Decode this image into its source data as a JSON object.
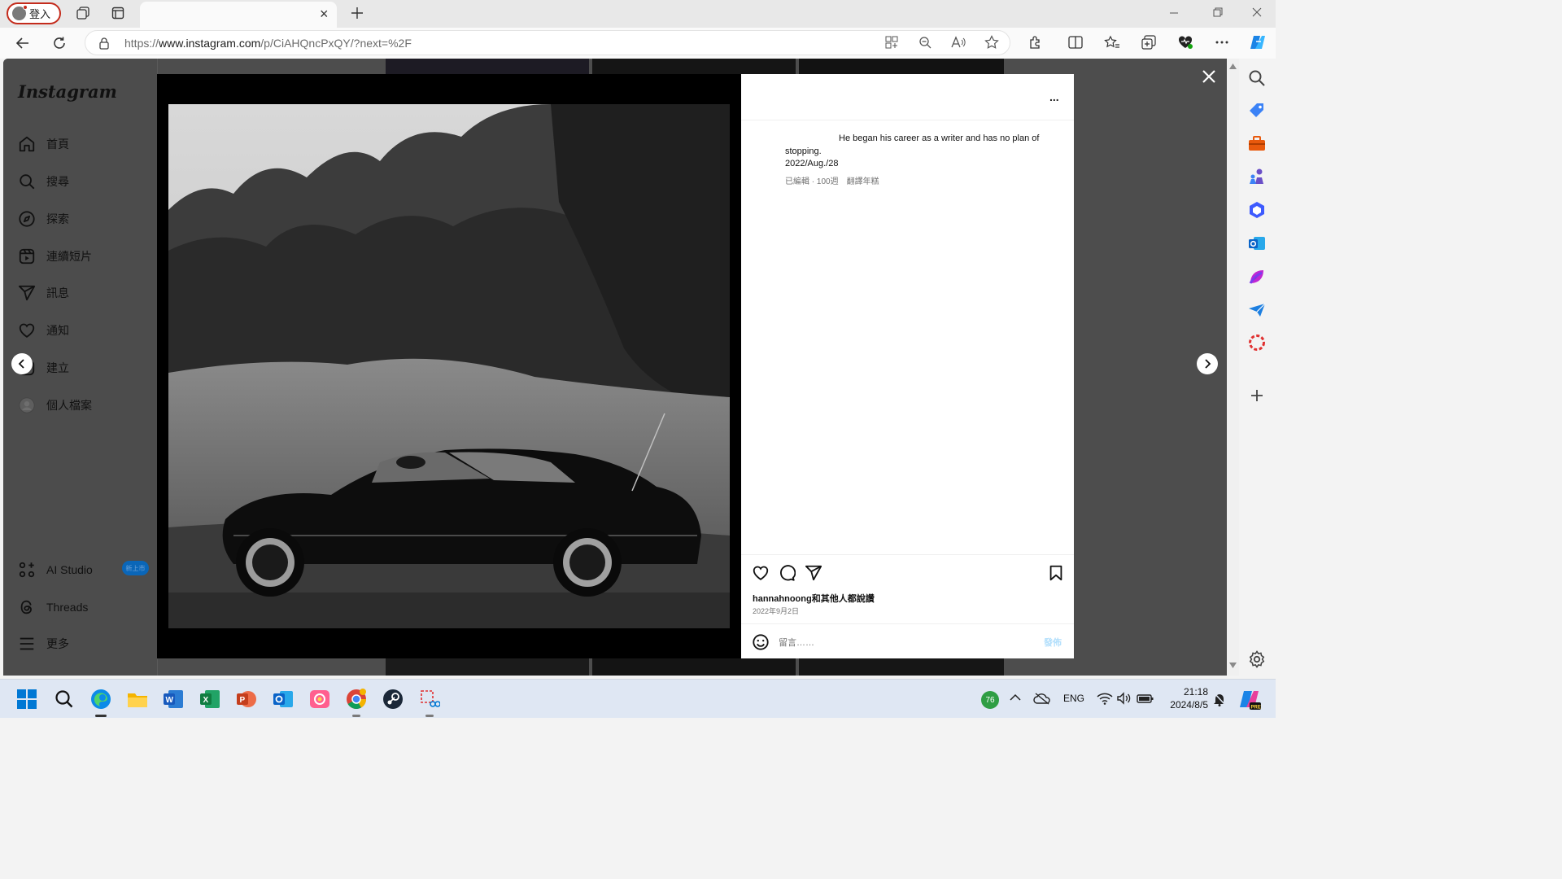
{
  "browser": {
    "profile_label": "登入",
    "tab_title": "",
    "tab_close": "×",
    "url_prefix": "https://",
    "url_host": "www.instagram.com",
    "url_path": "/p/CiAHQncPxQY/?next=%2F"
  },
  "instagram": {
    "logo": "Instagram",
    "nav": [
      {
        "label": "首頁",
        "icon": "home-icon"
      },
      {
        "label": "搜尋",
        "icon": "search-icon"
      },
      {
        "label": "探索",
        "icon": "explore-icon"
      },
      {
        "label": "連續短片",
        "icon": "reels-icon"
      },
      {
        "label": "訊息",
        "icon": "messages-icon"
      },
      {
        "label": "通知",
        "icon": "heart-icon"
      },
      {
        "label": "建立",
        "icon": "create-icon"
      },
      {
        "label": "個人檔案",
        "icon": "avatar-icon"
      }
    ],
    "bottom_nav": [
      {
        "label": "AI Studio",
        "icon": "ai-studio-icon"
      },
      {
        "label": "Threads",
        "icon": "threads-icon"
      },
      {
        "label": "更多",
        "icon": "menu-icon"
      }
    ],
    "new_badge": "新上市"
  },
  "post": {
    "more_label": "...",
    "caption_line1": "He began his career as a writer and has no plan of",
    "caption_line2": "stopping.",
    "caption_date": "2022/Aug./28",
    "meta_edited": "已編輯 · 100週",
    "meta_translate": "翻譯年糕",
    "likes_text": "hannahnoong和其他人都說讚",
    "post_date": "2022年9月2日",
    "comment_placeholder": "留言……",
    "post_button": "發佈"
  },
  "taskbar": {
    "weather_temp": "76",
    "language": "ENG",
    "time": "21:18",
    "date": "2024/8/5"
  }
}
